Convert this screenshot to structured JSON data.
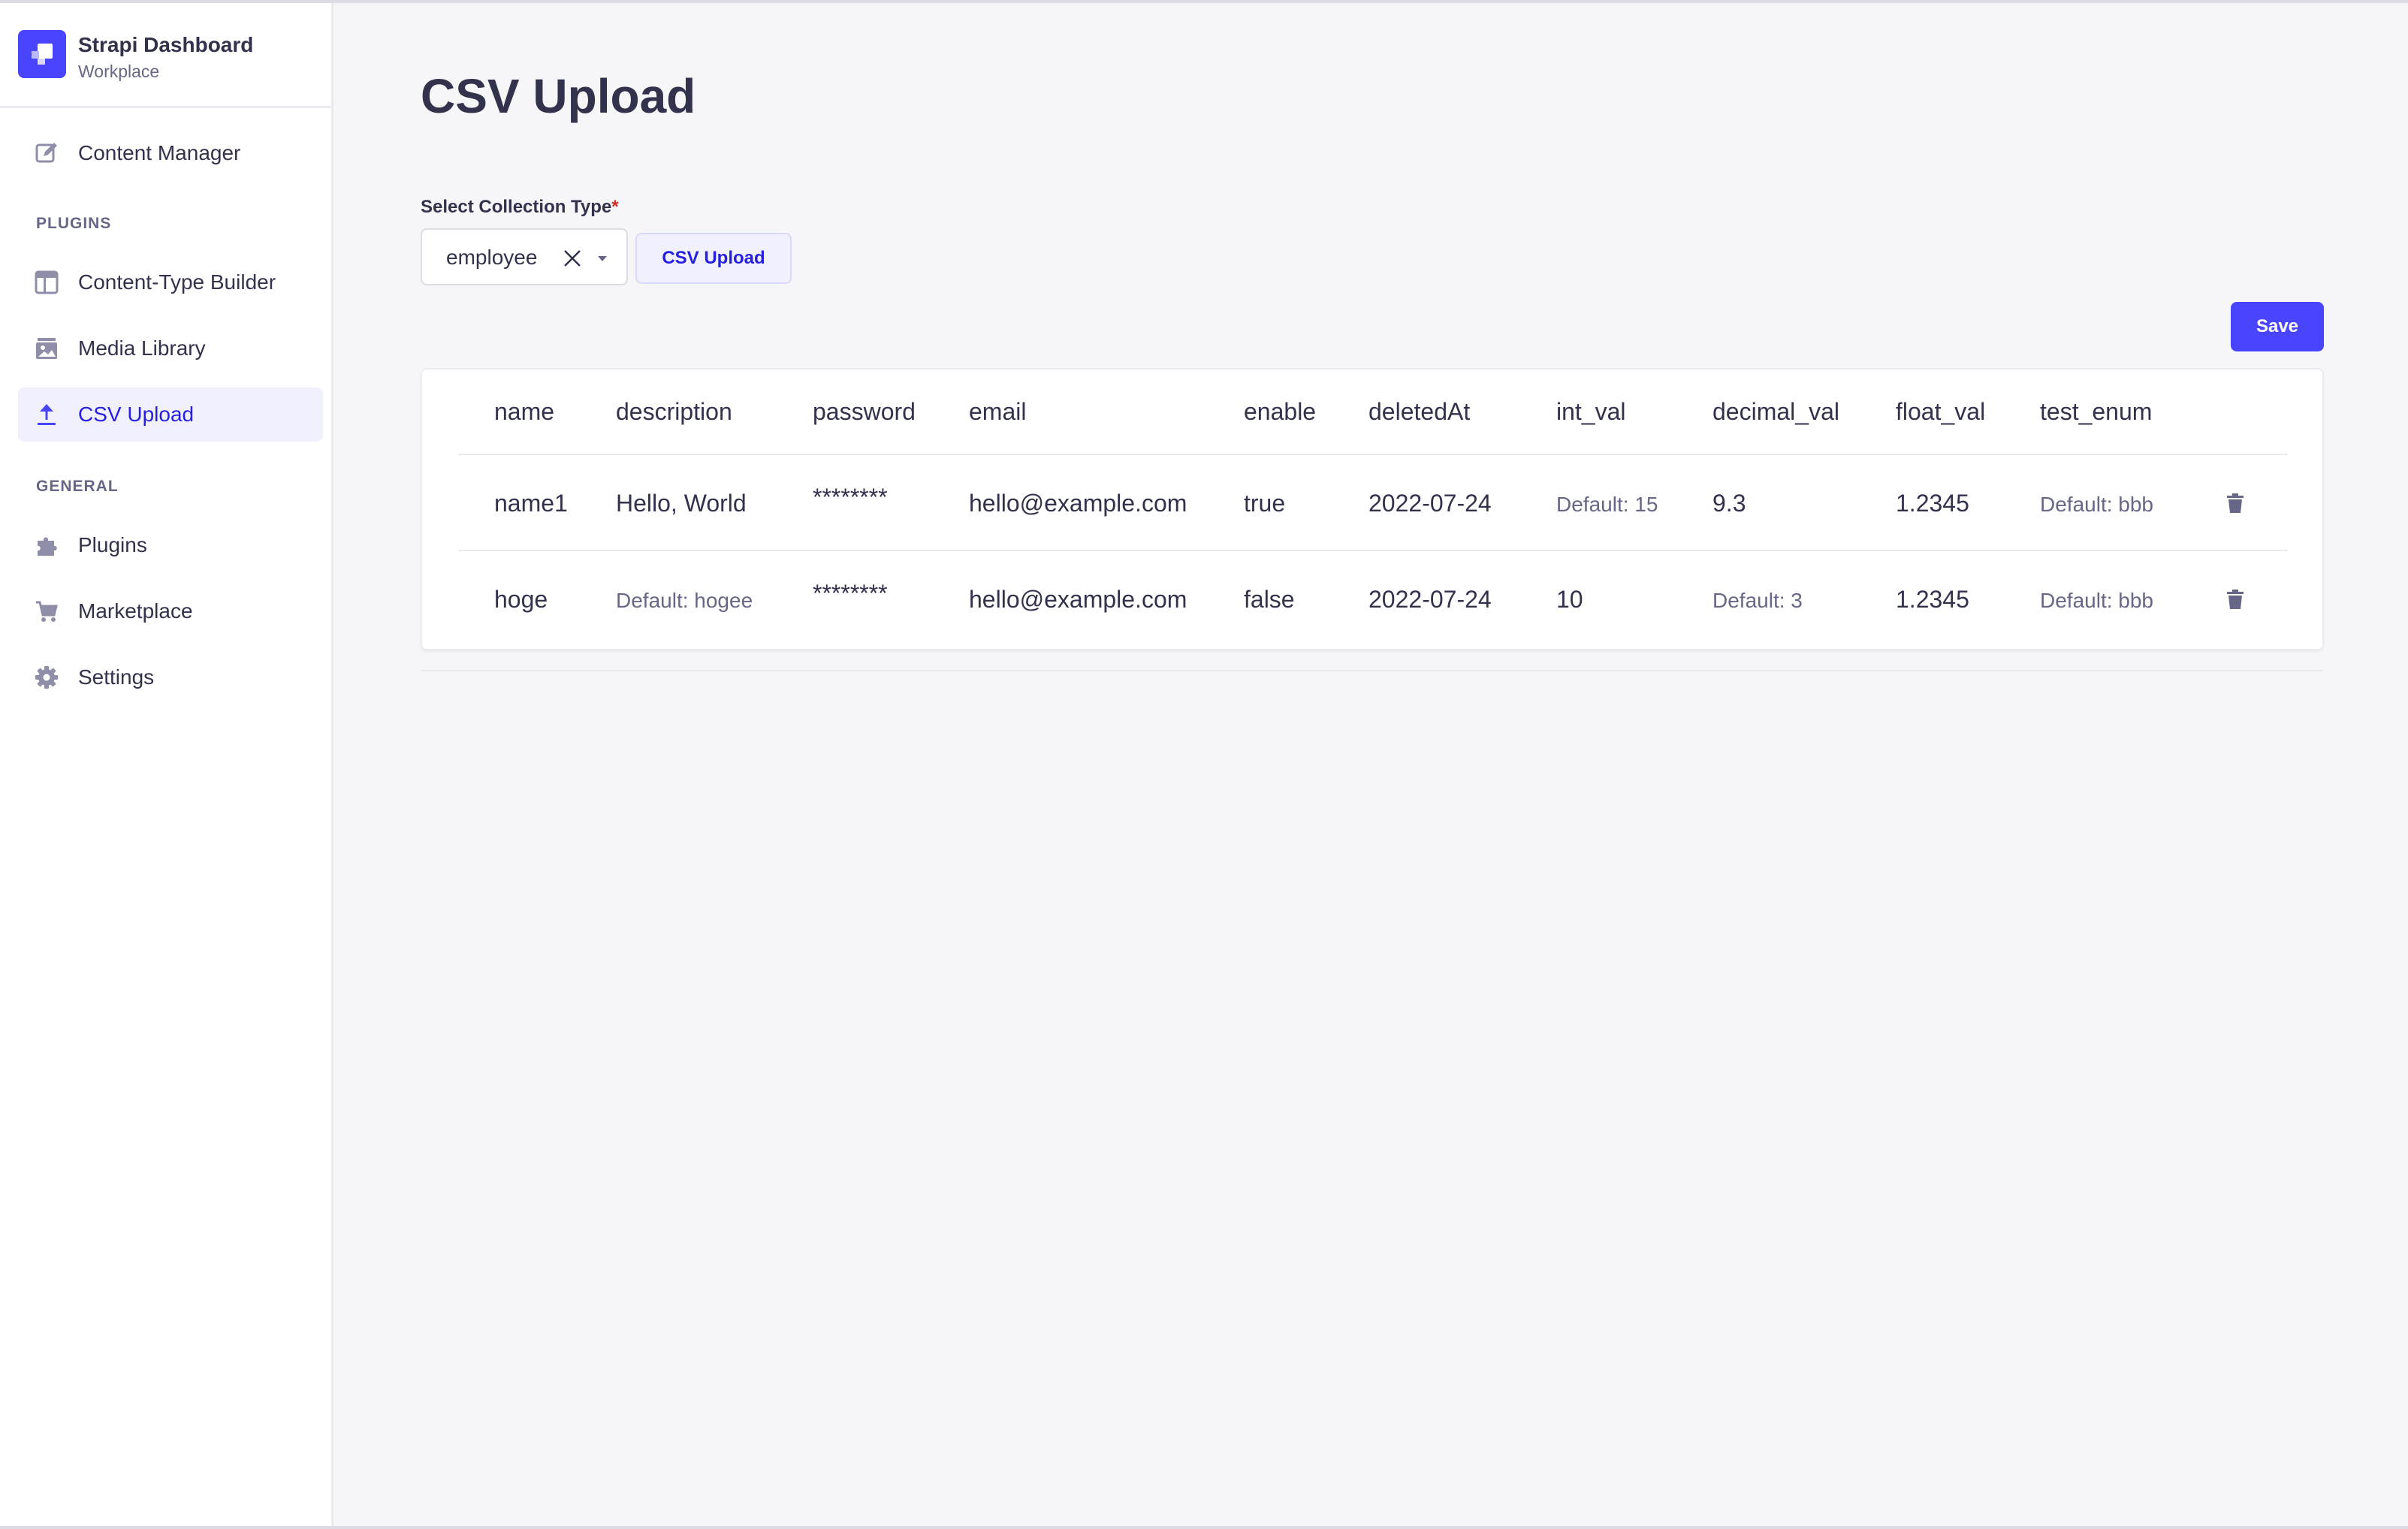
{
  "brand": {
    "title": "Strapi Dashboard",
    "subtitle": "Workplace"
  },
  "sidebar": {
    "items_top": [
      {
        "label": "Content Manager",
        "icon": "pencil-icon"
      }
    ],
    "plugins_label": "PLUGINS",
    "plugins": [
      {
        "label": "Content-Type Builder",
        "icon": "layout-icon"
      },
      {
        "label": "Media Library",
        "icon": "image-icon"
      },
      {
        "label": "CSV Upload",
        "icon": "upload-icon",
        "active": true
      }
    ],
    "general_label": "GENERAL",
    "general": [
      {
        "label": "Plugins",
        "icon": "puzzle-icon"
      },
      {
        "label": "Marketplace",
        "icon": "cart-icon"
      },
      {
        "label": "Settings",
        "icon": "gear-icon"
      }
    ]
  },
  "main": {
    "title": "CSV Upload",
    "select_label": "Select Collection Type",
    "required_mark": "*",
    "select_value": "employee",
    "upload_button": "CSV Upload",
    "save_button": "Save"
  },
  "table": {
    "headers": [
      "name",
      "description",
      "password",
      "email",
      "enable",
      "deletedAt",
      "int_val",
      "decimal_val",
      "float_val",
      "test_enum"
    ],
    "rows": [
      {
        "cells": [
          "name1",
          "Hello, World",
          "********",
          "hello@example.com",
          "true",
          "2022-07-24",
          "Default: 15",
          "9.3",
          "1.2345",
          "Default: bbb"
        ],
        "muted": [
          false,
          false,
          false,
          false,
          false,
          false,
          true,
          false,
          false,
          true
        ]
      },
      {
        "cells": [
          "hoge",
          "Default: hogee",
          "********",
          "hello@example.com",
          "false",
          "2022-07-24",
          "10",
          "Default: 3",
          "1.2345",
          "Default: bbb"
        ],
        "muted": [
          false,
          true,
          false,
          false,
          false,
          false,
          false,
          true,
          false,
          true
        ]
      }
    ]
  },
  "colors": {
    "primary": "#4945ff",
    "active_bg": "#f0f0ff",
    "active_text": "#271fe0",
    "text": "#32324d",
    "muted_text": "#666687",
    "page_bg": "#f6f6f9"
  }
}
